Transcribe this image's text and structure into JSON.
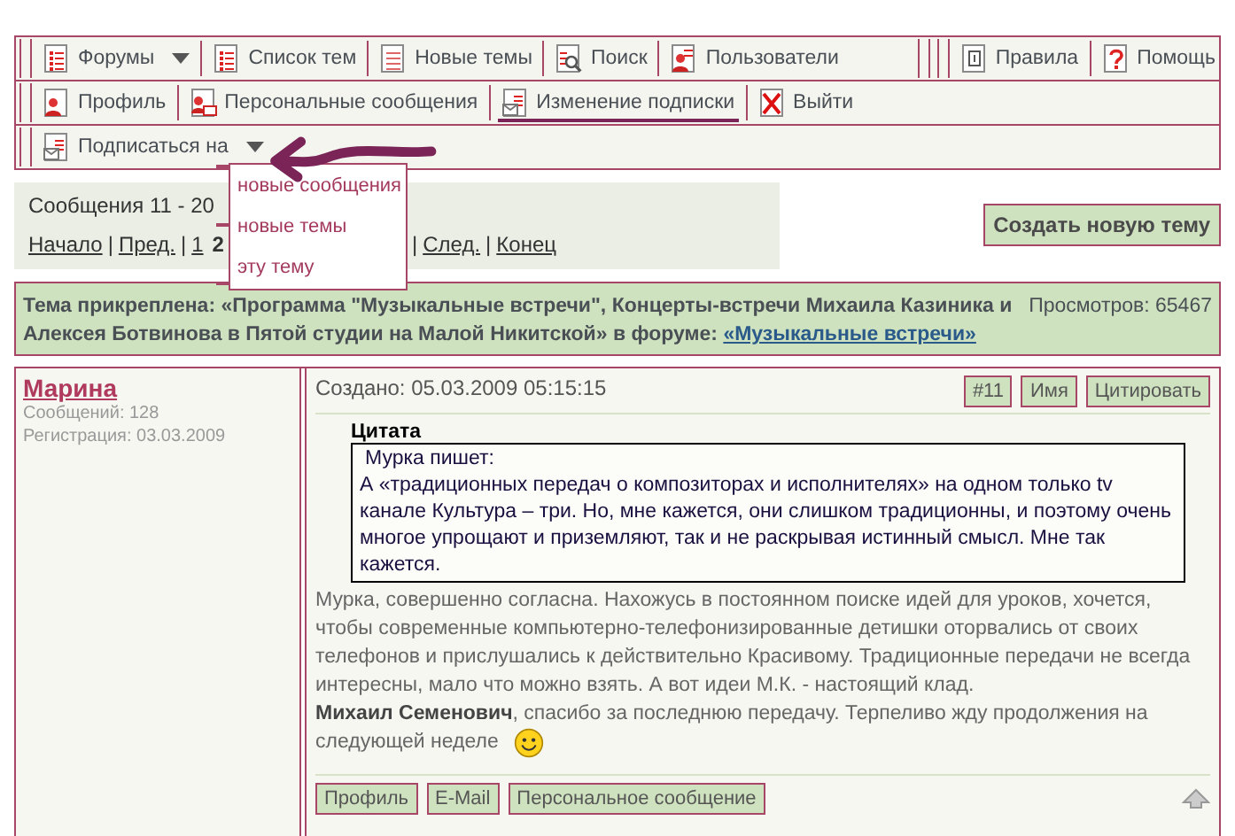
{
  "menu": {
    "rows": [
      {
        "groups": [
          [
            {
              "label": "Форумы",
              "kind": "list",
              "caret": true,
              "annotated": false
            },
            {
              "label": "Список тем",
              "kind": "list",
              "caret": false,
              "annotated": false
            },
            {
              "label": "Новые темы",
              "kind": "lines",
              "caret": false,
              "annotated": false
            },
            {
              "label": "Поиск",
              "kind": "search",
              "caret": false,
              "annotated": false
            },
            {
              "label": "Пользователи",
              "kind": "users",
              "caret": false,
              "annotated": false
            }
          ],
          [
            {
              "label": "Правила",
              "kind": "rules",
              "caret": false,
              "annotated": false
            },
            {
              "label": "Помощь",
              "kind": "help",
              "caret": false,
              "annotated": false
            }
          ]
        ]
      },
      {
        "groups": [
          [
            {
              "label": "Профиль",
              "kind": "profile",
              "caret": false,
              "annotated": false
            },
            {
              "label": "Персональные сообщения",
              "kind": "pm",
              "caret": false,
              "annotated": false
            },
            {
              "label": "Изменение подписки",
              "kind": "subscribe",
              "caret": false,
              "annotated": true
            },
            {
              "label": "Выйти",
              "kind": "exit",
              "caret": false,
              "annotated": false
            }
          ]
        ]
      },
      {
        "groups": [
          [
            {
              "label": "Подписаться на",
              "kind": "subscribe",
              "caret": true,
              "annotated": false
            }
          ]
        ]
      }
    ]
  },
  "dropdown": {
    "items": [
      {
        "label": "новые сообщения",
        "marked": true
      },
      {
        "label": "новые темы",
        "marked": true
      },
      {
        "label": "эту тему",
        "marked": true
      }
    ]
  },
  "pagination": {
    "summary": "Сообщения 11 - 20",
    "tokens": [
      {
        "kind": "link",
        "text": "Начало"
      },
      {
        "kind": "sep",
        "text": "|"
      },
      {
        "kind": "link",
        "text": "Пред."
      },
      {
        "kind": "sep",
        "text": "|"
      },
      {
        "kind": "link",
        "text": "1"
      },
      {
        "kind": "current",
        "text": "2"
      },
      {
        "kind": "hidden"
      },
      {
        "kind": "sep",
        "text": "|"
      },
      {
        "kind": "link",
        "text": "След."
      },
      {
        "kind": "sep",
        "text": "|"
      },
      {
        "kind": "link",
        "text": "Конец"
      }
    ]
  },
  "create_topic": "Создать новую тему",
  "topic": {
    "text": "Тема прикреплена: «Программа \"Музыкальные встречи\", Концерты-встречи Михаила Казиника и Алексея Ботвинова в Пятой студии на Малой Никитской» в форуме:",
    "forum_link": "«Музыкальные встречи»",
    "views": "Просмотров: 65467"
  },
  "post": {
    "author": "Марина",
    "posts": "Сообщений: 128",
    "registered": "Регистрация: 03.03.2009",
    "created": "Создано: 05.03.2009 05:15:15",
    "actions": [
      "#11",
      "Имя",
      "Цитировать"
    ],
    "quote": {
      "title": "Цитата",
      "author_line": "Мурка пишет:",
      "text": "А «традиционных передач о композиторах и исполнителях» на одном только tv канале Культура – три. Но, мне кажется, они слишком традиционны, и поэтому очень многое упрощают и приземляют, так и не раскрывая истинный смысл. Мне так кажется."
    },
    "paragraphs": [
      "Мурка, совершенно согласна. Нахожусь в постоянном поиске идей для уроков, хочется, чтобы современные компьютерно-телефонизированные детишки оторвались от своих телефонов и прислушались к действительно Красивому. Традиционные передачи не всегда интересны, мало что можно взять. А вот идеи М.К. - настоящий клад.",
      "**Михаил Семенович**, спасибо за последнюю передачу. Терпеливо жду продолжения на следующей неделе"
    ],
    "smiley": true,
    "footer_buttons": [
      "Профиль",
      "E-Mail",
      "Персональное сообщение"
    ]
  }
}
